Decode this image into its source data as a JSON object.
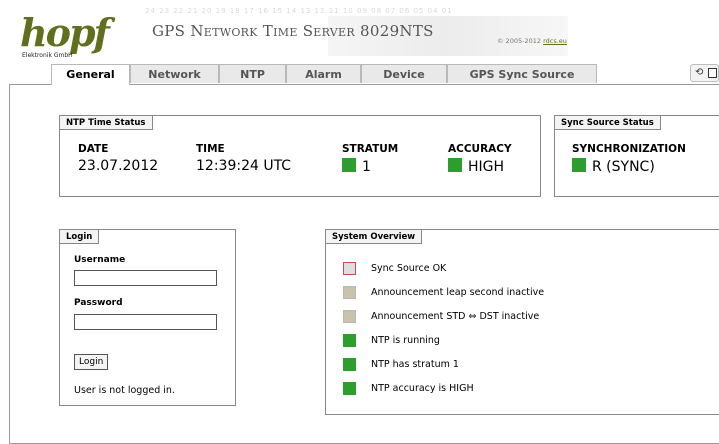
{
  "header": {
    "logo_text": "hopf",
    "logo_subtext": "Elektronik GmbH",
    "digit_strip": "24 23 22 21 20 19 18 17 16 15 14 13 12 11 10 09 08 07 06 05 04 01",
    "title": "GPS Network Time Server 8029NTS",
    "copyright_text": "© 2005-2012",
    "copyright_link": "rdcs.eu"
  },
  "tabs": [
    {
      "label": "General",
      "active": true
    },
    {
      "label": "Network",
      "active": false
    },
    {
      "label": "NTP",
      "active": false
    },
    {
      "label": "Alarm",
      "active": false
    },
    {
      "label": "Device",
      "active": false
    },
    {
      "label": "GPS Sync Source",
      "active": false
    }
  ],
  "icons": {
    "refresh": "refresh-icon",
    "window": "new-window-icon"
  },
  "ntp_time_status": {
    "title": "NTP Time Status",
    "date_label": "DATE",
    "date_value": "23.07.2012",
    "time_label": "TIME",
    "time_value": "12:39:24 UTC",
    "stratum_label": "STRATUM",
    "stratum_value": "1",
    "accuracy_label": "ACCURACY",
    "accuracy_value": "HIGH"
  },
  "sync_source_status": {
    "title": "Sync Source Status",
    "sync_label": "SYNCHRONIZATION",
    "sync_value": "R (SYNC)"
  },
  "login": {
    "title": "Login",
    "username_label": "Username",
    "username_value": "",
    "password_label": "Password",
    "password_value": "",
    "button_label": "Login",
    "status": "User is not logged in."
  },
  "system_overview": {
    "title": "System Overview",
    "items": [
      {
        "text": "Sync Source OK",
        "status": "red-outline"
      },
      {
        "text": "Announcement leap second inactive",
        "status": "inactive"
      },
      {
        "text": "Announcement STD ⇔ DST inactive",
        "status": "inactive"
      },
      {
        "text": "NTP is running",
        "status": "ok"
      },
      {
        "text": "NTP has stratum 1",
        "status": "ok"
      },
      {
        "text": "NTP accuracy is HIGH",
        "status": "ok"
      }
    ]
  },
  "colors": {
    "ok": "#2d9d2d",
    "inactive_fill": "#c9c2ad",
    "inactive_border": "#b8b8b8",
    "red_outline_fill": "#dedede",
    "red_outline_border": "#c05050",
    "brand": "#5f6f1d"
  }
}
